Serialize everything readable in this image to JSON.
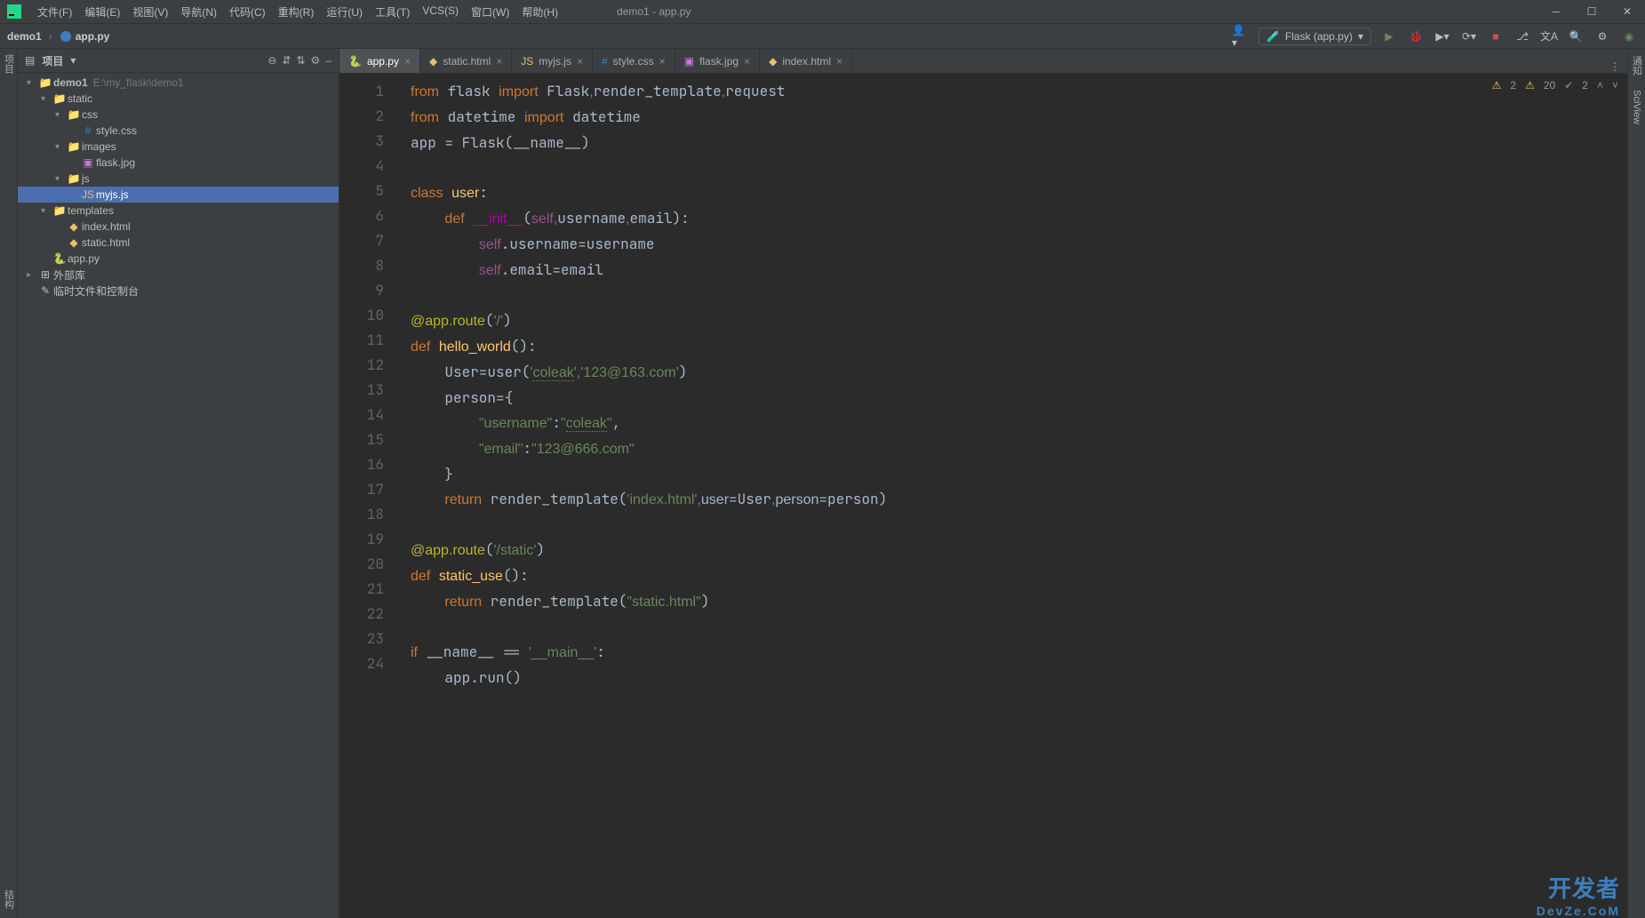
{
  "window": {
    "title": "demo1 - app.py"
  },
  "menu": [
    "文件(F)",
    "编辑(E)",
    "视图(V)",
    "导航(N)",
    "代码(C)",
    "重构(R)",
    "运行(U)",
    "工具(T)",
    "VCS(S)",
    "窗口(W)",
    "帮助(H)"
  ],
  "breadcrumb": {
    "project": "demo1",
    "file": "app.py"
  },
  "runConfig": {
    "label": "Flask (app.py)"
  },
  "sidebar": {
    "title": "项目",
    "tools": [
      "⊖",
      "⇵",
      "⇅",
      "⚙",
      "–"
    ],
    "tree": [
      {
        "depth": 0,
        "arrow": "▾",
        "icon": "folder",
        "text": "demo1",
        "dim": "E:\\my_flask\\demo1",
        "bold": true
      },
      {
        "depth": 1,
        "arrow": "▾",
        "icon": "folder",
        "text": "static"
      },
      {
        "depth": 2,
        "arrow": "▾",
        "icon": "folder",
        "text": "css"
      },
      {
        "depth": 3,
        "arrow": "",
        "icon": "css",
        "text": "style.css"
      },
      {
        "depth": 2,
        "arrow": "▾",
        "icon": "folder",
        "text": "images"
      },
      {
        "depth": 3,
        "arrow": "",
        "icon": "jpg",
        "text": "flask.jpg"
      },
      {
        "depth": 2,
        "arrow": "▾",
        "icon": "folder",
        "text": "js"
      },
      {
        "depth": 3,
        "arrow": "",
        "icon": "js",
        "text": "myjs.js",
        "selected": true
      },
      {
        "depth": 1,
        "arrow": "▾",
        "icon": "folder",
        "text": "templates"
      },
      {
        "depth": 2,
        "arrow": "",
        "icon": "html",
        "text": "index.html"
      },
      {
        "depth": 2,
        "arrow": "",
        "icon": "html",
        "text": "static.html"
      },
      {
        "depth": 1,
        "arrow": "",
        "icon": "py",
        "text": "app.py"
      },
      {
        "depth": 0,
        "arrow": "▸",
        "icon": "lib",
        "text": "外部库"
      },
      {
        "depth": 0,
        "arrow": "",
        "icon": "scratch",
        "text": "临时文件和控制台"
      }
    ]
  },
  "tabs": [
    {
      "label": "app.py",
      "icon": "py",
      "active": true
    },
    {
      "label": "static.html",
      "icon": "html"
    },
    {
      "label": "myjs.js",
      "icon": "js"
    },
    {
      "label": "style.css",
      "icon": "css"
    },
    {
      "label": "flask.jpg",
      "icon": "jpg"
    },
    {
      "label": "index.html",
      "icon": "html"
    }
  ],
  "inspections": {
    "warn1": "2",
    "warn2": "20",
    "ok": "2"
  },
  "leftRail": {
    "project": "项目",
    "structure": "结构"
  },
  "rightRail": {
    "notifications": "通知",
    "sciview": "SciView"
  },
  "code": {
    "lines": 24
  },
  "watermark": {
    "main": "开发者",
    "sub": "DevZe.CoM"
  }
}
